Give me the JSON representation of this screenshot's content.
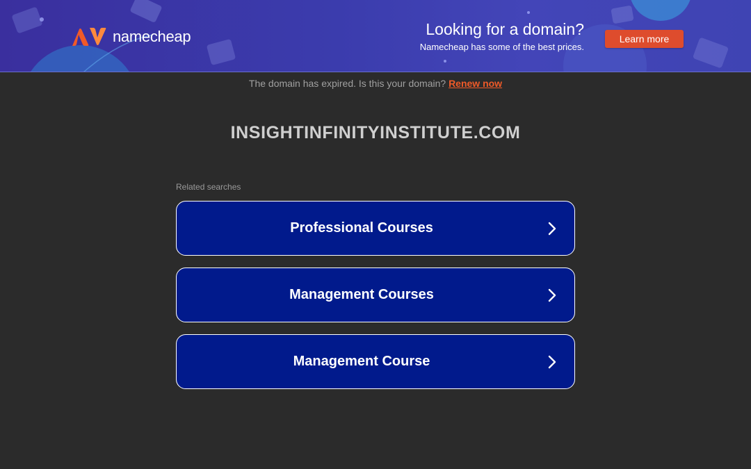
{
  "banner": {
    "logo_text": "namecheap",
    "promo_title": "Looking for a domain?",
    "promo_subtitle": "Namecheap has some of the best prices.",
    "cta_label": "Learn more",
    "brand_color": "#f05a28",
    "cta_color": "#de4c2d"
  },
  "notice": {
    "text": "The domain has expired. Is this your domain? ",
    "link_label": "Renew now"
  },
  "domain": "INSIGHTINFINITYINSTITUTE.COM",
  "related": {
    "label": "Related searches",
    "items": [
      {
        "label": "Professional Courses",
        "icon": "chevron-right-icon"
      },
      {
        "label": "Management Courses",
        "icon": "chevron-right-icon"
      },
      {
        "label": "Management Course",
        "icon": "chevron-right-icon"
      }
    ]
  },
  "colors": {
    "background": "#2b2b2b",
    "button_fill": "#011a8c",
    "banner": "#3b3cad"
  }
}
